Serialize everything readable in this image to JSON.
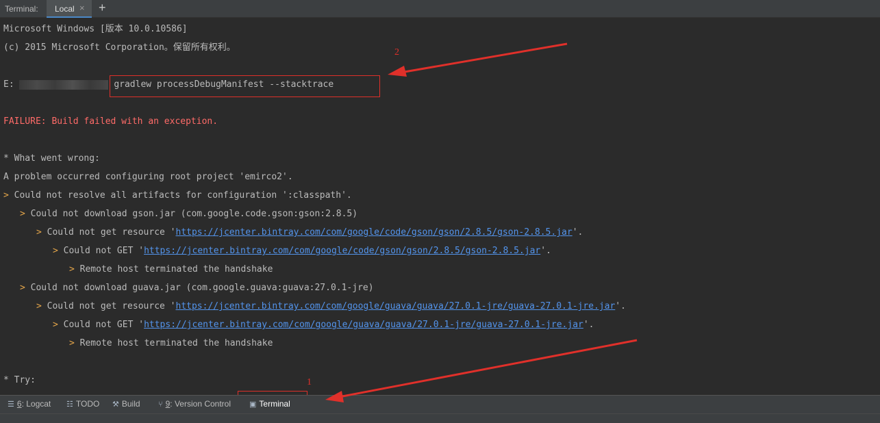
{
  "tabbar": {
    "title": "Terminal:",
    "active_tab": "Local",
    "close_glyph": "×",
    "add_glyph": "+"
  },
  "terminal": {
    "lines": {
      "l0": "Microsoft Windows [版本 10.0.10586]",
      "l1": "(c) 2015 Microsoft Corporation。保留所有权利。",
      "l3_prefix": "E:",
      "l3_cmd": "gradlew processDebugManifest --stacktrace",
      "l5": "FAILURE: Build failed with an exception.",
      "l7": "* What went wrong:",
      "l8": "A problem occurred configuring root project 'emirco2'.",
      "l9": "Could not resolve all artifacts for configuration ':classpath'.",
      "l10": "Could not download gson.jar (com.google.code.gson:gson:2.8.5)",
      "l11_pre": "Could not get resource '",
      "l11_link": "https://jcenter.bintray.com/com/google/code/gson/gson/2.8.5/gson-2.8.5.jar",
      "l11_post": "'.",
      "l12_pre": "Could not GET '",
      "l12_link": "https://jcenter.bintray.com/com/google/code/gson/gson/2.8.5/gson-2.8.5.jar",
      "l12_post": "'.",
      "l13": "Remote host terminated the handshake",
      "l14": "Could not download guava.jar (com.google.guava:guava:27.0.1-jre)",
      "l15_pre": "Could not get resource '",
      "l15_link": "https://jcenter.bintray.com/com/google/guava/guava/27.0.1-jre/guava-27.0.1-jre.jar",
      "l15_post": "'.",
      "l16_pre": "Could not GET '",
      "l16_link": "https://jcenter.bintray.com/com/google/guava/guava/27.0.1-jre/guava-27.0.1-jre.jar",
      "l16_post": "'.",
      "l17": "Remote host terminated the handshake",
      "l19": "* Try:"
    },
    "tree_marker": ">"
  },
  "annotations": {
    "label_1": "1",
    "label_2": "2",
    "color": "#e0302a"
  },
  "status_bar": {
    "logcat_num": "6",
    "logcat_rest": ": Logcat",
    "todo": "TODO",
    "build": "Build",
    "vc_num": "9",
    "vc_rest": ": Version Control",
    "terminal": "Terminal"
  },
  "colors": {
    "background": "#2b2b2b",
    "text": "#bbbbbb",
    "failure": "#ff6b68",
    "link": "#5394ec",
    "tree_marker": "#e5a64a"
  }
}
